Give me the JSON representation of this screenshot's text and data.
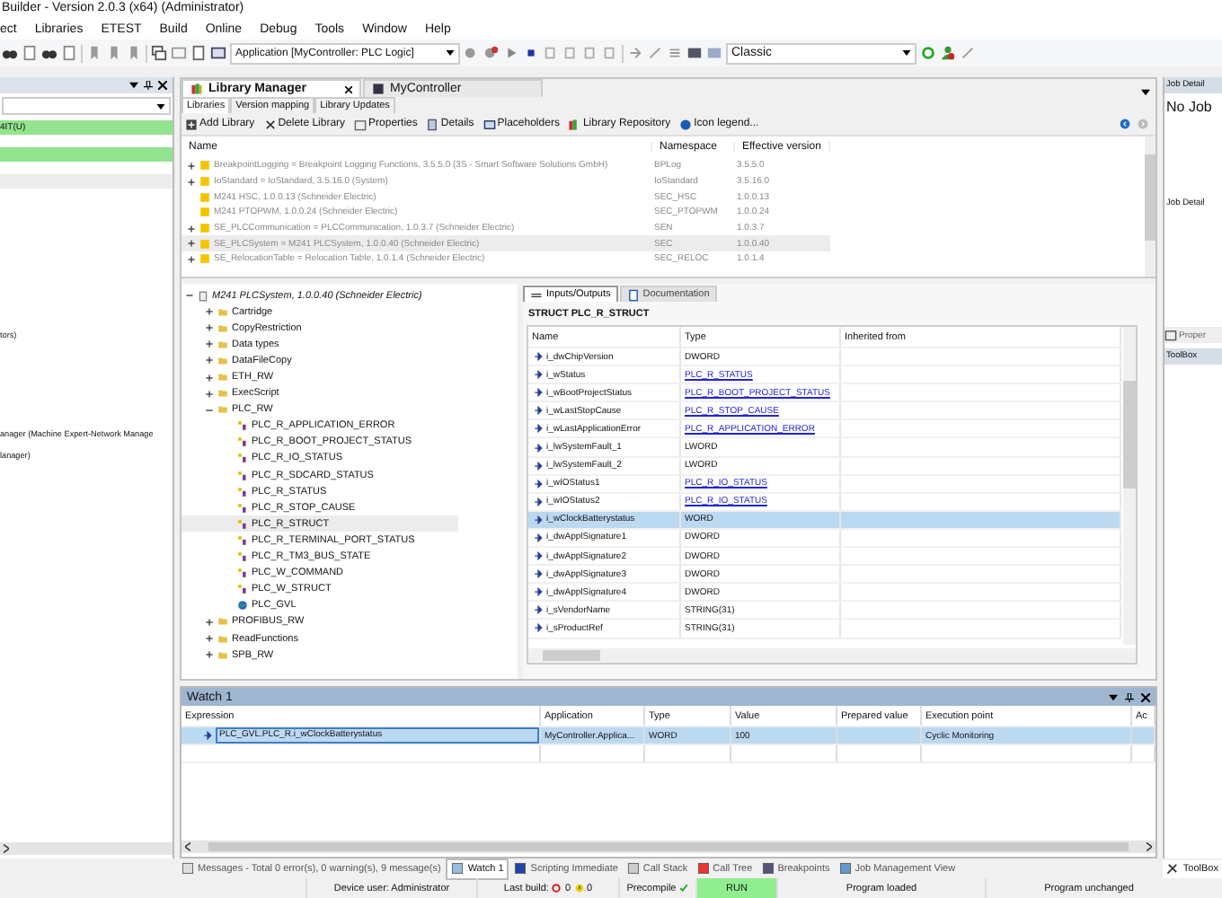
{
  "window": {
    "title": "Builder - Version 2.0.3 (x64) (Administrator)"
  },
  "menu": [
    "ect",
    "Libraries",
    "ETEST",
    "Build",
    "Online",
    "Debug",
    "Tools",
    "Window",
    "Help"
  ],
  "toolbar": {
    "application": "Application [MyController: PLC Logic]",
    "profile": "Classic"
  },
  "left_panel": {
    "bands": [
      {
        "kind": "green",
        "text": "4IT(U)"
      },
      {
        "kind": "green"
      },
      {
        "kind": "gray"
      }
    ],
    "lines": [
      "tors)",
      "anager (Machine Expert-Network Manage",
      "lanager)"
    ]
  },
  "editor_tabs": [
    {
      "label": "Library Manager",
      "selected": true
    },
    {
      "label": "MyController",
      "selected": false
    }
  ],
  "library_tabs": [
    {
      "label": "Libraries",
      "selected": true
    },
    {
      "label": "Version mapping",
      "selected": false
    },
    {
      "label": "Library Updates",
      "selected": false
    }
  ],
  "library_toolbar": [
    "Add Library",
    "Delete Library",
    "Properties",
    "Details",
    "Placeholders",
    "Library Repository",
    "Icon legend..."
  ],
  "library_table": {
    "columns": [
      "Name",
      "Namespace",
      "Effective version"
    ],
    "rows": [
      {
        "name": "BreakpointLogging = Breakpoint Logging Functions, 3.5.5.0 (3S - Smart Software Solutions GmbH)",
        "namespace": "BPLog",
        "version": "3.5.5.0",
        "expanded": false,
        "selected": false
      },
      {
        "name": "IoStandard = IoStandard, 3.5.16.0 (System)",
        "namespace": "IoStandard",
        "version": "3.5.16.0",
        "expanded": false,
        "selected": false
      },
      {
        "name": "M241 HSC, 1.0.0.13 (Schneider Electric)",
        "namespace": "SEC_HSC",
        "version": "1.0.0.13",
        "selected": false
      },
      {
        "name": "M241 PTOPWM, 1.0.0.24 (Schneider Electric)",
        "namespace": "SEC_PTOPWM",
        "version": "1.0.0.24",
        "selected": false
      },
      {
        "name": "SE_PLCCommunication = PLCCommunication, 1.0.3.7 (Schneider Electric)",
        "namespace": "SEN",
        "version": "1.0.3.7",
        "expanded": false,
        "selected": false
      },
      {
        "name": "SE_PLCSystem = M241 PLCSystem, 1.0.0.40 (Schneider Electric)",
        "namespace": "SEC",
        "version": "1.0.0.40",
        "expanded": false,
        "selected": true
      },
      {
        "name": "SE_RelocationTable = Relocation Table, 1.0.1.4 (Schneider Electric)",
        "namespace": "SEC_RELOC",
        "version": "1.0.1.4",
        "expanded": false,
        "selected": false
      }
    ]
  },
  "tree": {
    "root": {
      "label": "M241 PLCSystem, 1.0.0.40 (Schneider Electric)",
      "kind": "library",
      "expanded": true,
      "selected": false,
      "children": [
        {
          "label": "Cartridge",
          "kind": "folder",
          "expanded": false,
          "selected": false
        },
        {
          "label": "CopyRestriction",
          "kind": "folder",
          "expanded": false,
          "selected": false
        },
        {
          "label": "Data types",
          "kind": "folder",
          "expanded": false,
          "selected": false
        },
        {
          "label": "DataFileCopy",
          "kind": "folder",
          "expanded": false,
          "selected": false
        },
        {
          "label": "ETH_RW",
          "kind": "folder",
          "expanded": false,
          "selected": false
        },
        {
          "label": "ExecScript",
          "kind": "folder",
          "expanded": false,
          "selected": false
        },
        {
          "label": "PLC_RW",
          "kind": "folder",
          "expanded": true,
          "selected": false,
          "children": [
            {
              "label": "PLC_R_APPLICATION_ERROR",
              "kind": "type",
              "selected": false
            },
            {
              "label": "PLC_R_BOOT_PROJECT_STATUS",
              "kind": "type",
              "selected": false
            },
            {
              "label": "PLC_R_IO_STATUS",
              "kind": "type",
              "selected": false
            },
            {
              "label": "PLC_R_SDCARD_STATUS",
              "kind": "type",
              "selected": false
            },
            {
              "label": "PLC_R_STATUS",
              "kind": "type",
              "selected": false
            },
            {
              "label": "PLC_R_STOP_CAUSE",
              "kind": "type",
              "selected": false
            },
            {
              "label": "PLC_R_STRUCT",
              "kind": "type",
              "selected": true
            },
            {
              "label": "PLC_R_TERMINAL_PORT_STATUS",
              "kind": "type",
              "selected": false
            },
            {
              "label": "PLC_R_TM3_BUS_STATE",
              "kind": "type",
              "selected": false
            },
            {
              "label": "PLC_W_COMMAND",
              "kind": "type",
              "selected": false
            },
            {
              "label": "PLC_W_STRUCT",
              "kind": "type",
              "selected": false
            },
            {
              "label": "PLC_GVL",
              "kind": "gvl",
              "selected": false
            }
          ]
        },
        {
          "label": "PROFIBUS_RW",
          "kind": "folder",
          "expanded": false,
          "selected": false
        },
        {
          "label": "ReadFunctions",
          "kind": "folder",
          "expanded": false,
          "selected": false
        },
        {
          "label": "SPB_RW",
          "kind": "folder",
          "expanded": false,
          "selected": false
        }
      ]
    }
  },
  "detail_tabs": [
    {
      "label": "Inputs/Outputs",
      "selected": true
    },
    {
      "label": "Documentation",
      "selected": false
    }
  ],
  "struct": {
    "title": "STRUCT  PLC_R_STRUCT",
    "columns": [
      "Name",
      "Type",
      "Inherited from"
    ],
    "rows": [
      {
        "name": "i_dwChipVersion",
        "type": "DWORD",
        "kind": "plain",
        "selected": false
      },
      {
        "name": "i_wStatus",
        "type": "PLC_R_STATUS",
        "kind": "link",
        "selected": false
      },
      {
        "name": "i_wBootProjectStatus",
        "type": "PLC_R_BOOT_PROJECT_STATUS",
        "kind": "link",
        "selected": false
      },
      {
        "name": "i_wLastStopCause",
        "type": "PLC_R_STOP_CAUSE",
        "kind": "link",
        "selected": false
      },
      {
        "name": "i_wLastApplicationError",
        "type": "PLC_R_APPLICATION_ERROR",
        "kind": "link",
        "selected": false
      },
      {
        "name": "i_lwSystemFault_1",
        "type": "LWORD",
        "kind": "plain",
        "selected": false
      },
      {
        "name": "i_lwSystemFault_2",
        "type": "LWORD",
        "kind": "plain",
        "selected": false
      },
      {
        "name": "i_wIOStatus1",
        "type": "PLC_R_IO_STATUS",
        "kind": "link",
        "selected": false
      },
      {
        "name": "i_wIOStatus2",
        "type": "PLC_R_IO_STATUS",
        "kind": "link",
        "selected": false
      },
      {
        "name": "i_wClockBatterystatus",
        "type": "WORD",
        "kind": "plain",
        "selected": true
      },
      {
        "name": "i_dwApplSignature1",
        "type": "DWORD",
        "kind": "plain",
        "selected": false
      },
      {
        "name": "i_dwApplSignature2",
        "type": "DWORD",
        "kind": "plain",
        "selected": false
      },
      {
        "name": "i_dwApplSignature3",
        "type": "DWORD",
        "kind": "plain",
        "selected": false
      },
      {
        "name": "i_dwApplSignature4",
        "type": "DWORD",
        "kind": "plain",
        "selected": false
      },
      {
        "name": "i_sVendorName",
        "type": "STRING(31)",
        "kind": "plain",
        "selected": false
      },
      {
        "name": "i_sProductRef",
        "type": "STRING(31)",
        "kind": "plain",
        "selected": false
      }
    ]
  },
  "right_panel": {
    "header": "Job Detail",
    "message": "No Job",
    "subheader": "Job Detail",
    "properties_tab": "Proper",
    "toolbox_header": "ToolBox"
  },
  "watch": {
    "title": "Watch 1",
    "columns": [
      "Expression",
      "Application",
      "Type",
      "Value",
      "Prepared value",
      "Execution point",
      "Ac"
    ],
    "rows": [
      {
        "expression": "PLC_GVL.PLC_R.i_wClockBatterystatus",
        "application": "MyController.Applica...",
        "type": "WORD",
        "value": "100",
        "execution_point": "Cyclic Monitoring",
        "selected": true
      }
    ]
  },
  "bottom_tabs": [
    {
      "label": "Messages - Total 0 error(s), 0 warning(s), 9 message(s)",
      "selected": false
    },
    {
      "label": "Watch 1",
      "selected": true
    },
    {
      "label": "Scripting Immediate",
      "selected": false
    },
    {
      "label": "Call Stack",
      "selected": false
    },
    {
      "label": "Call Tree",
      "selected": false
    },
    {
      "label": "Breakpoints",
      "selected": false
    },
    {
      "label": "Job Management View",
      "selected": false
    }
  ],
  "toolbox_tab": "ToolBox",
  "status_bar": {
    "device_user": "Device user: Administrator",
    "last_build": "Last build:",
    "errors": "0",
    "warnings": "0",
    "precompile": "Precompile",
    "run_state": "RUN",
    "program_state": "Program loaded",
    "change_state": "Program unchanged"
  }
}
